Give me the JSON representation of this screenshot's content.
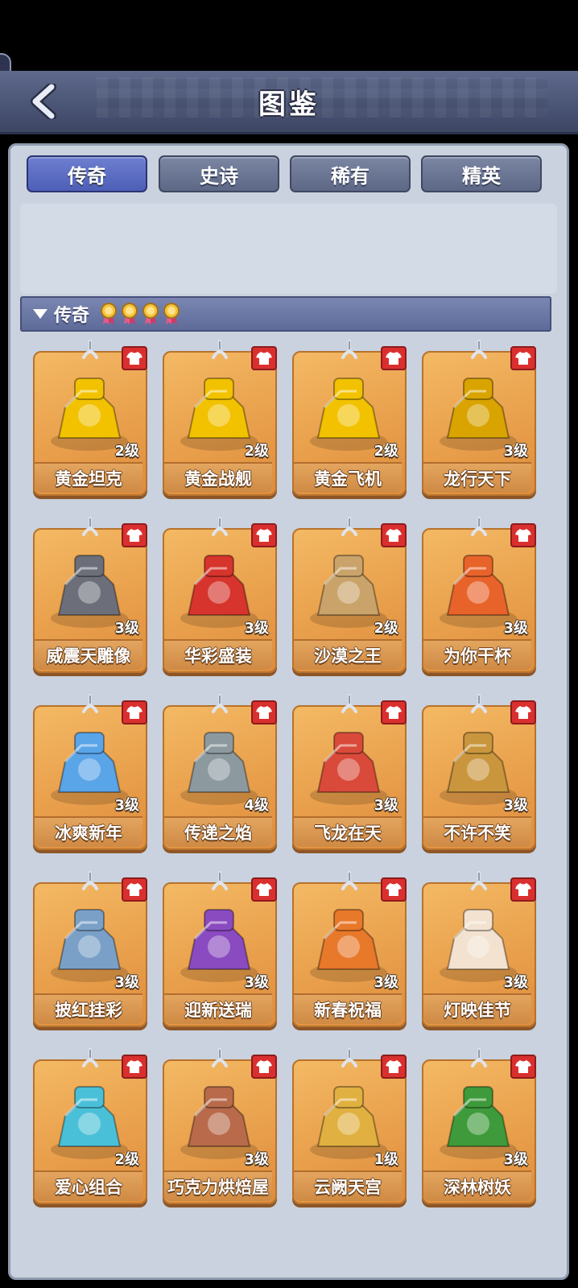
{
  "header": {
    "title": "图鉴"
  },
  "tabs": [
    {
      "label": "传奇",
      "active": true
    },
    {
      "label": "史诗",
      "active": false
    },
    {
      "label": "稀有",
      "active": false
    },
    {
      "label": "精英",
      "active": false
    }
  ],
  "section": {
    "title": "传奇",
    "medal_count": 4
  },
  "cards": [
    {
      "name": "黄金坦克",
      "level": "2级",
      "icon": "golden-tank",
      "color": "#f2c200"
    },
    {
      "name": "黄金战舰",
      "level": "2级",
      "icon": "golden-battleship",
      "color": "#f2c200"
    },
    {
      "name": "黄金飞机",
      "level": "2级",
      "icon": "golden-airplane",
      "color": "#f2c200"
    },
    {
      "name": "龙行天下",
      "level": "3级",
      "icon": "golden-dragon-boat",
      "color": "#d9a400"
    },
    {
      "name": "威震天雕像",
      "level": "3级",
      "icon": "robot-statue",
      "color": "#6c6f7a"
    },
    {
      "name": "华彩盛装",
      "level": "3级",
      "icon": "carnival-float",
      "color": "#d6342c"
    },
    {
      "name": "沙漠之王",
      "level": "2级",
      "icon": "desert-palace",
      "color": "#c9a36a"
    },
    {
      "name": "为你干杯",
      "level": "3级",
      "icon": "turkey",
      "color": "#e8632a"
    },
    {
      "name": "冰爽新年",
      "level": "3级",
      "icon": "ice-2022",
      "color": "#5aa4e8"
    },
    {
      "name": "传递之焰",
      "level": "4级",
      "icon": "torch-rock",
      "color": "#8c9aa0"
    },
    {
      "name": "飞龙在天",
      "level": "3级",
      "icon": "flying-dragon",
      "color": "#d94a3a"
    },
    {
      "name": "不许不笑",
      "level": "3级",
      "icon": "bronze-figures",
      "color": "#c9963d"
    },
    {
      "name": "披红挂彩",
      "level": "3级",
      "icon": "lion-statue",
      "color": "#7aa0c8"
    },
    {
      "name": "迎新送瑞",
      "level": "3级",
      "icon": "purple-beast",
      "color": "#8a4ac0"
    },
    {
      "name": "新春祝福",
      "level": "3级",
      "icon": "tiger-statue",
      "color": "#e8782a"
    },
    {
      "name": "灯映佳节",
      "level": "3级",
      "icon": "rabbit-lantern",
      "color": "#f3e2d0"
    },
    {
      "name": "爱心组合",
      "level": "2级",
      "icon": "love-bears",
      "color": "#4ac0d8"
    },
    {
      "name": "巧克力烘焙屋",
      "level": "3级",
      "icon": "chocolate-bakery",
      "color": "#b86a4a"
    },
    {
      "name": "云阙天宫",
      "level": "1级",
      "icon": "cloud-palace",
      "color": "#e0b040"
    },
    {
      "name": "深林树妖",
      "level": "3级",
      "icon": "tree-ent",
      "color": "#3e9a3a"
    }
  ]
}
